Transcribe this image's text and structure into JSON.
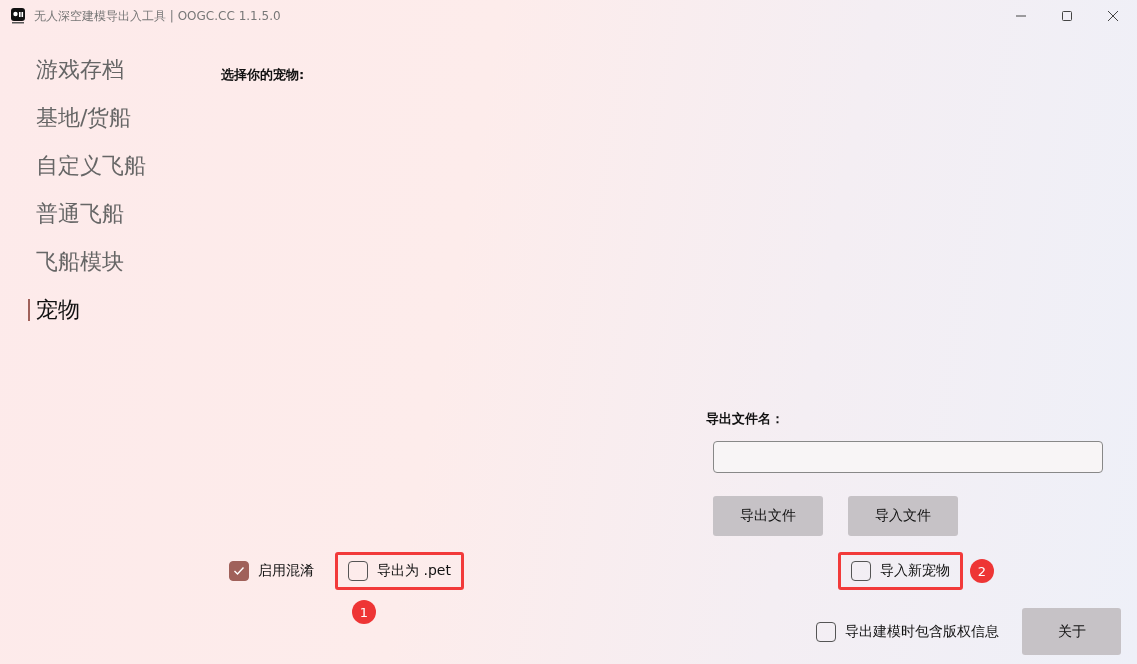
{
  "window": {
    "title": "无人深空建模导出入工具 | OOGC.CC 1.1.5.0"
  },
  "sidebar": {
    "items": [
      {
        "label": "游戏存档",
        "selected": false
      },
      {
        "label": "基地/货船",
        "selected": false
      },
      {
        "label": "自定义飞船",
        "selected": false
      },
      {
        "label": "普通飞船",
        "selected": false
      },
      {
        "label": "飞船模块",
        "selected": false
      },
      {
        "label": "宠物",
        "selected": true
      }
    ]
  },
  "main": {
    "prompt": "选择你的宠物:",
    "export_filename": {
      "label": "导出文件名："
    },
    "buttons": [
      "导出文件",
      "导入文件"
    ],
    "options": [
      {
        "label": "启用混淆",
        "checked": true,
        "highlighted": false
      },
      {
        "label": "导出为 .pet",
        "checked": false,
        "highlighted": true,
        "badge": "1"
      },
      {
        "label": "导入新宠物",
        "checked": false,
        "highlighted": true,
        "badge": "2"
      }
    ],
    "copyright_option": {
      "label": "导出建模时包含版权信息",
      "checked": false
    },
    "about_button": "关于"
  }
}
